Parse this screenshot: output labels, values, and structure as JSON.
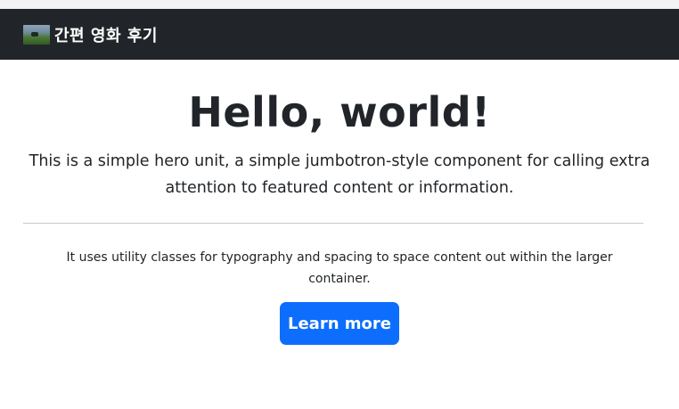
{
  "navbar": {
    "brand_text": "간편 영화 후기",
    "logo_icon": "movie-thumbnail-logo"
  },
  "hero": {
    "title": "Hello, world!",
    "lead": "This is a simple hero unit, a simple jumbotron-style component for calling extra attention to featured content or information.",
    "text": "It uses utility classes for typography and spacing to space content out within the larger container.",
    "button_label": "Learn more"
  },
  "colors": {
    "navbar_bg": "#212529",
    "primary": "#0d6efd",
    "text": "#212529"
  }
}
